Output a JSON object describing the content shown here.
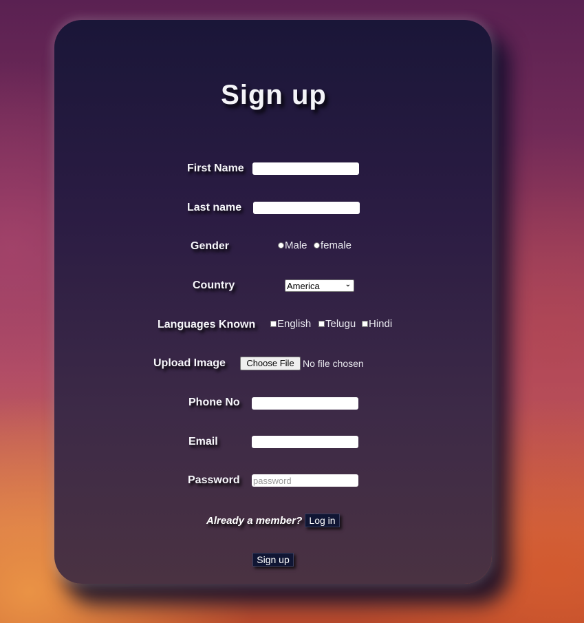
{
  "form": {
    "title": "Sign up",
    "first_name_label": "First Name",
    "last_name_label": "Last name",
    "gender_label": "Gender",
    "gender_options": [
      "Male",
      "female"
    ],
    "country_label": "Country",
    "country_selected": "America",
    "languages_label": "Languages Known",
    "language_options": [
      "English",
      "Telugu",
      "Hindi"
    ],
    "upload_label": "Upload Image",
    "file_button_label": "Choose File",
    "file_status": "No file chosen",
    "phone_label": "Phone No",
    "email_label": "Email",
    "password_label": "Password",
    "password_placeholder": "password",
    "member_text": "Already a member?",
    "login_button": "Log in",
    "signup_button": "Sign up"
  }
}
